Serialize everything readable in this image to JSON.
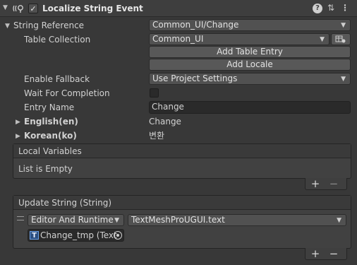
{
  "header": {
    "title": "Localize String Event",
    "enabled_check": "✓",
    "help_glyph": "?",
    "preset_glyph": "⇅",
    "more_glyph": "⋮"
  },
  "string_reference": {
    "label": "String Reference",
    "value": "Common_UI/Change"
  },
  "table_collection": {
    "label": "Table Collection",
    "value": "Common_UI",
    "add_table_entry": "Add Table Entry",
    "add_locale": "Add Locale"
  },
  "enable_fallback": {
    "label": "Enable Fallback",
    "value": "Use Project Settings"
  },
  "wait_for_completion": {
    "label": "Wait For Completion"
  },
  "entry_name": {
    "label": "Entry Name",
    "value": "Change"
  },
  "locales": [
    {
      "label": "English(en)",
      "value": "Change"
    },
    {
      "label": "Korean(ko)",
      "value": "변환"
    }
  ],
  "local_variables": {
    "title": "Local Variables",
    "empty_text": "List is Empty"
  },
  "update_string": {
    "title": "Update String (String)",
    "mode": "Editor And Runtime",
    "function": "TextMeshProUGUI.text",
    "target_object": "Change_tmp (Text",
    "target_icon_glyph": "T"
  },
  "list_controls": {
    "add": "+",
    "remove": "−"
  },
  "colors": {
    "background": "#383838",
    "field": "#515151",
    "text": "#d2d2d2",
    "object_icon": "#3a7bd5"
  },
  "icons": [
    "component-icon",
    "checkbox-check-icon",
    "help-icon",
    "presets-icon",
    "more-icon",
    "foldout-arrow-icon",
    "dropdown-caret-icon",
    "table-picker-icon",
    "drag-handle-icon",
    "object-picker-icon",
    "text-component-icon"
  ]
}
